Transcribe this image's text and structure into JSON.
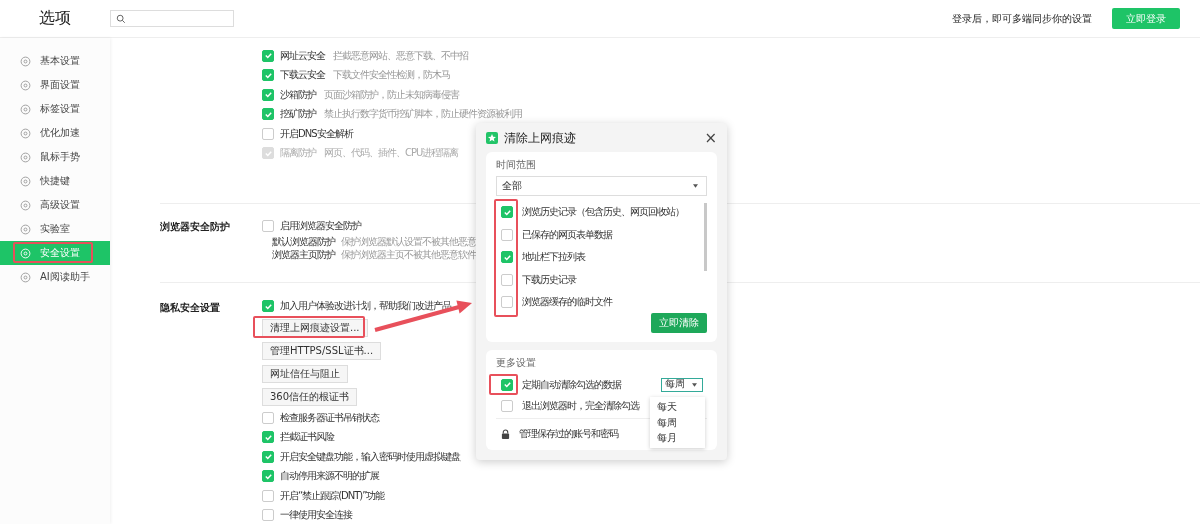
{
  "header": {
    "title": "选项",
    "login_hint": "登录后，即可多端同步你的设置",
    "login_button": "立即登录"
  },
  "sidebar": {
    "items": [
      {
        "label": "基本设置",
        "selected": false,
        "highlighted": false
      },
      {
        "label": "界面设置",
        "selected": false,
        "highlighted": false
      },
      {
        "label": "标签设置",
        "selected": false,
        "highlighted": false
      },
      {
        "label": "优化加速",
        "selected": false,
        "highlighted": false
      },
      {
        "label": "鼠标手势",
        "selected": false,
        "highlighted": false
      },
      {
        "label": "快捷键",
        "selected": false,
        "highlighted": false
      },
      {
        "label": "高级设置",
        "selected": false,
        "highlighted": false
      },
      {
        "label": "实验室",
        "selected": false,
        "highlighted": false
      },
      {
        "label": "安全设置",
        "selected": true,
        "highlighted": true
      },
      {
        "label": "AI阅读助手",
        "selected": false,
        "highlighted": false
      }
    ]
  },
  "sections": [
    {
      "items": [
        {
          "kind": "checkbox",
          "label": "网址云安全",
          "description": "拦截恶意网站、恶意下载、不中招",
          "checked": true,
          "disabled": false
        },
        {
          "kind": "checkbox",
          "label": "下载云安全",
          "description": "下载文件安全性检测，防木马",
          "checked": true,
          "disabled": false
        },
        {
          "kind": "checkbox",
          "label": "沙箱防护",
          "description": "页面沙箱防护，防止未知病毒侵害",
          "checked": true,
          "disabled": false
        },
        {
          "kind": "checkbox",
          "label": "挖矿防护",
          "description": "禁止执行数字货币挖矿脚本，防止硬件资源被利用",
          "checked": true,
          "disabled": false
        },
        {
          "kind": "checkbox",
          "label": "开启DNS安全解析",
          "checked": false,
          "disabled": false
        },
        {
          "kind": "checkbox",
          "label": "隔离防护",
          "description": "网页、代码、插件、CPU进程隔离",
          "checked": true,
          "disabled": true
        }
      ]
    },
    {
      "title": "浏览器安全防护",
      "items": [
        {
          "kind": "checkbox",
          "label": "启用浏览器安全防护",
          "checked": false,
          "disabled": false
        },
        {
          "kind": "info",
          "label": "默认浏览器防护",
          "description": "保护浏览器默认设置不被其他恶意"
        },
        {
          "kind": "info",
          "label": "浏览器主页防护",
          "description": "保护浏览器主页不被其他恶意软件"
        }
      ]
    },
    {
      "title": "隐私安全设置",
      "items": [
        {
          "kind": "checkbox",
          "label": "加入用户体验改进计划，帮助我们改进产品",
          "checked": true,
          "disabled": false
        },
        {
          "kind": "button",
          "label": "清理上网痕迹设置...",
          "highlighted": true
        },
        {
          "kind": "button",
          "label": "管理HTTPS/SSL证书...",
          "highlighted": false
        },
        {
          "kind": "button",
          "label": "网址信任与阻止",
          "highlighted": false
        },
        {
          "kind": "button",
          "label": "360信任的根证书",
          "highlighted": false
        },
        {
          "kind": "checkbox",
          "label": "检查服务器证书吊销状态",
          "checked": false,
          "disabled": false
        },
        {
          "kind": "checkbox",
          "label": "拦截证书风险",
          "checked": true,
          "disabled": false
        },
        {
          "kind": "checkbox",
          "label": "开启安全键盘功能，输入密码时使用虚拟键盘",
          "checked": true,
          "disabled": false
        },
        {
          "kind": "checkbox",
          "label": "自动停用来源不明的扩展",
          "checked": true,
          "disabled": false
        },
        {
          "kind": "checkbox",
          "label": "开启“禁止跟踪(DNT)”功能",
          "checked": false,
          "disabled": false
        },
        {
          "kind": "checkbox",
          "label": "一律使用安全连接",
          "checked": false,
          "disabled": false
        }
      ]
    }
  ],
  "callout_arrow": true,
  "dialog": {
    "title": "清除上网痕迹",
    "close": "×",
    "time_range": {
      "label": "时间范围",
      "value": "全部"
    },
    "options_highlighted": true,
    "options": [
      {
        "label": "浏览历史记录（包含历史、网页回收站）",
        "checked": true
      },
      {
        "label": "已保存的网页表单数据",
        "checked": false
      },
      {
        "label": "地址栏下拉列表",
        "checked": true
      },
      {
        "label": "下载历史记录",
        "checked": false
      },
      {
        "label": "浏览器缓存的临时文件",
        "checked": false
      }
    ],
    "clear_button": "立即清除",
    "more": {
      "label": "更多设置",
      "periodic": {
        "label": "定期自动清除勾选的数据",
        "checked": true,
        "highlighted": true,
        "interval": "每周"
      },
      "on_exit": {
        "label": "退出浏览器时，完全清除勾选",
        "checked": false
      },
      "interval_options": [
        "每天",
        "每周",
        "每月"
      ],
      "passwords": "管理保存过的账号和密码"
    }
  }
}
